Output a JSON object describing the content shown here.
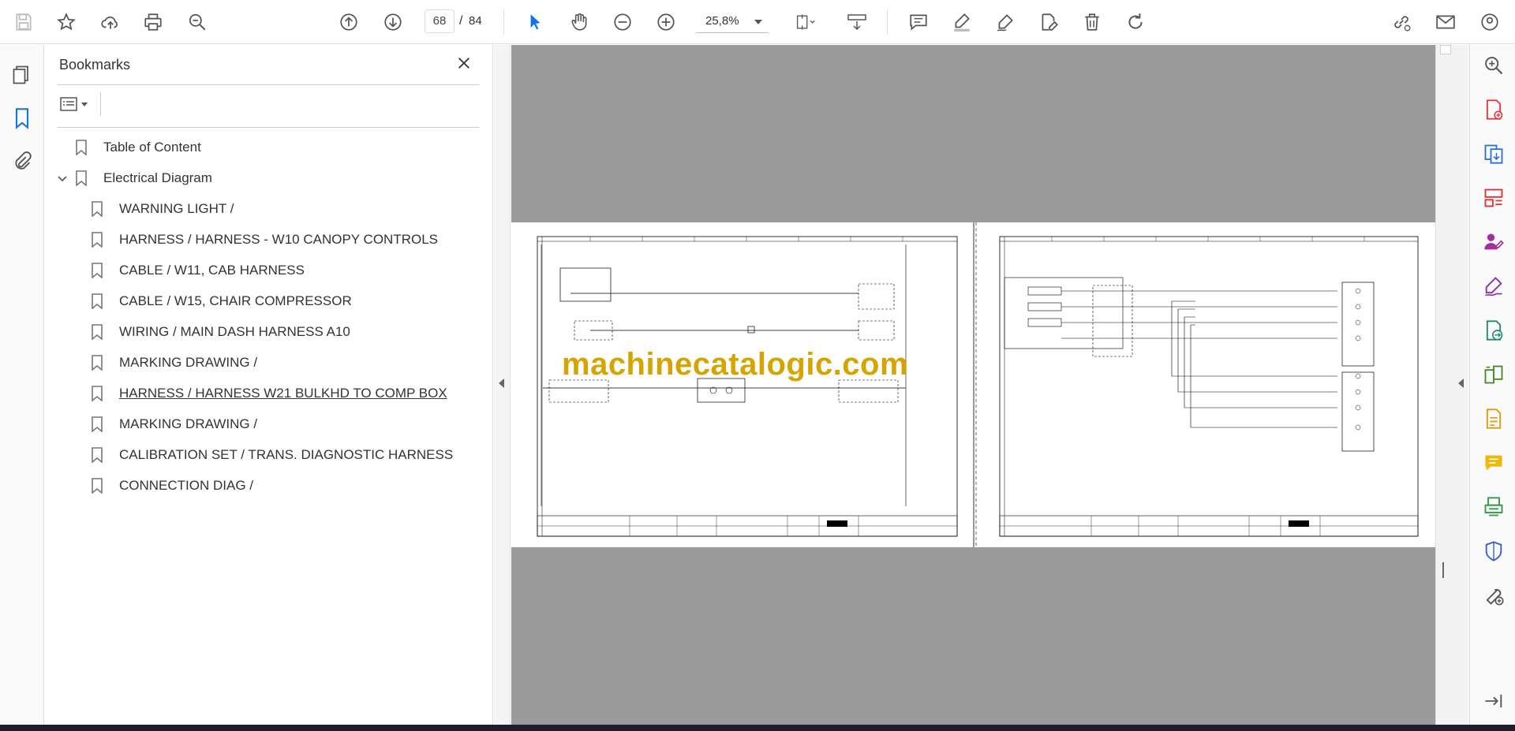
{
  "toolbar": {
    "page_current": "68",
    "page_separator": "/",
    "page_total": "84",
    "zoom": "25,8%"
  },
  "bookmarks": {
    "title": "Bookmarks",
    "items": [
      {
        "label": "Table of Content"
      },
      {
        "label": "Electrical Diagram"
      },
      {
        "label": "WARNING LIGHT /"
      },
      {
        "label": "HARNESS / HARNESS - W10 CANOPY CONTROLS"
      },
      {
        "label": "CABLE / W11, CAB HARNESS"
      },
      {
        "label": "CABLE / W15, CHAIR COMPRESSOR"
      },
      {
        "label": "WIRING / MAIN DASH HARNESS A10"
      },
      {
        "label": "MARKING DRAWING /"
      },
      {
        "label": "HARNESS / HARNESS W21 BULKHD TO COMP BOX"
      },
      {
        "label": "MARKING DRAWING /"
      },
      {
        "label": "CALIBRATION SET / TRANS. DIAGNOSTIC HARNESS"
      },
      {
        "label": "CONNECTION DIAG /"
      }
    ]
  },
  "document": {
    "watermark": "machinecatalogic.com"
  },
  "colors": {
    "accent": "#1473e6",
    "viewer_bg": "#9b9b9b",
    "watermark": "#d6a400"
  }
}
